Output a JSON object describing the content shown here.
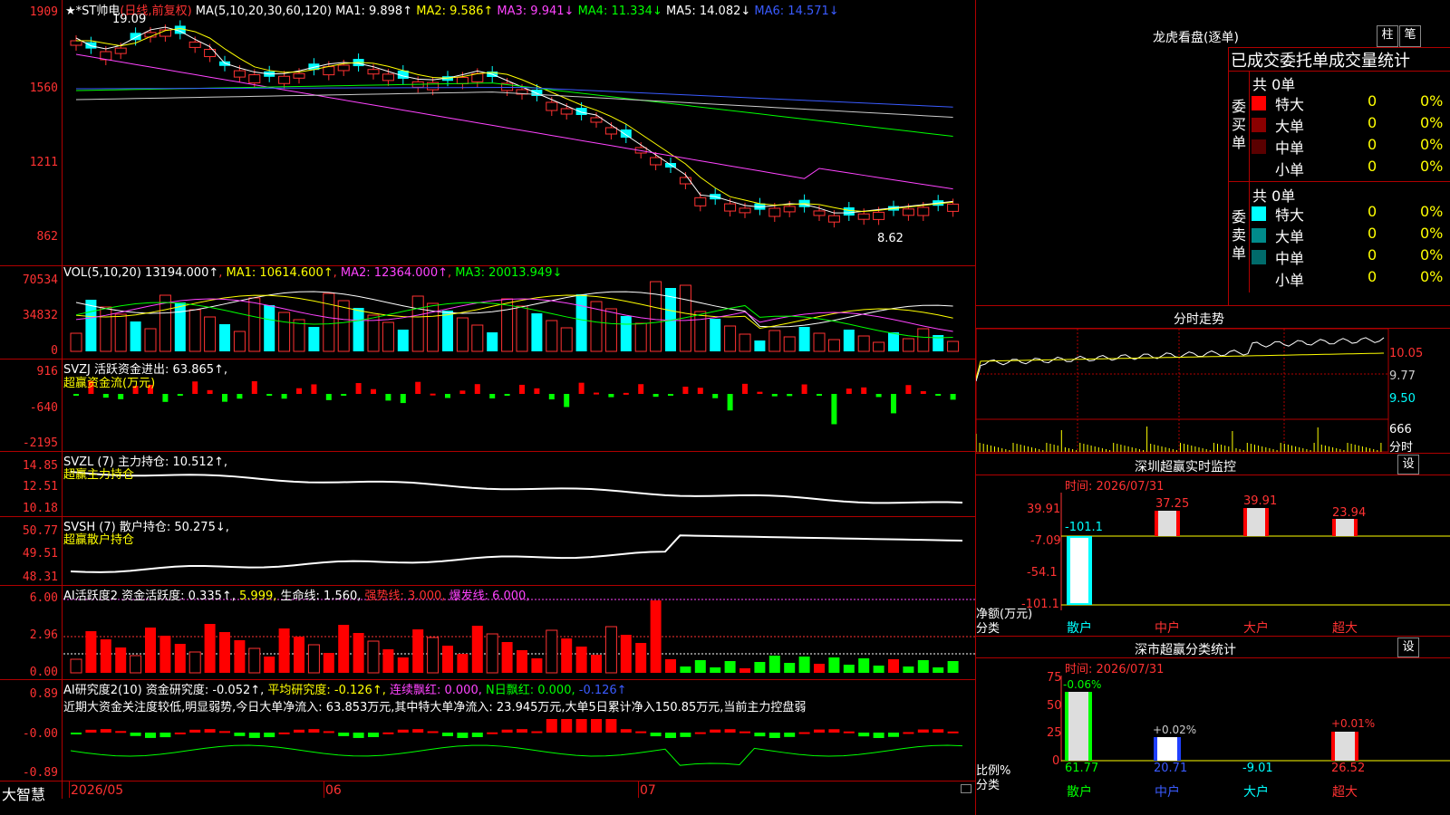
{
  "main_chart": {
    "title_stars": "★*ST帅电",
    "title_mode": "(日线,前复权)",
    "ma_label": "MA(5,10,20,30,60,120)",
    "ma1": "MA1: 9.898↑",
    "ma2": "MA2: 9.586↑",
    "ma3": "MA3: 9.941↓",
    "ma4": "MA4: 11.334↓",
    "ma5": "MA5: 14.082↓",
    "ma6": "MA6: 14.571↓",
    "y_ticks": [
      "1909",
      "1560",
      "1211",
      "862"
    ],
    "high_label": "19.09",
    "low_label": "8.62"
  },
  "vol_panel": {
    "label": "VOL(5,10,20)",
    "vol": "13194.000↑",
    "ma1": "MA1: 10614.600↑",
    "ma2": "MA2: 12364.000↑",
    "ma3": "MA3: 20013.949↓",
    "y_ticks": [
      "70534",
      "34832",
      "0"
    ]
  },
  "svzj_panel": {
    "label": "SVZJ  活跃资金进出: 63.865↑,",
    "sub": "超赢资金流(万元)",
    "y_ticks": [
      "916",
      "-640",
      "-2195"
    ]
  },
  "svzl_panel": {
    "label": "SVZL (7) 主力持仓: 10.512↑,",
    "sub": "超赢主力持仓",
    "y_ticks": [
      "14.85",
      "12.51",
      "10.18"
    ]
  },
  "svsh_panel": {
    "label": "SVSH (7) 散户持仓: 50.275↓,",
    "sub": "超赢散户持仓",
    "y_ticks": [
      "50.77",
      "49.51",
      "48.31"
    ]
  },
  "ai_active_panel": {
    "label1": "AI活跃度2 资金活跃度: 0.335↑,",
    "v2": "5.999,",
    "v3": "生命线: 1.560,",
    "v4": "强势线: 3.000,",
    "v5": "爆发线: 6.000,",
    "y_ticks": [
      "6.00",
      "2.96",
      "0.00"
    ]
  },
  "ai_research_panel": {
    "label1": "AI研究度2(10) 资金研究度: -0.052↑,",
    "v2": "平均研究度: -0.126↑,",
    "v3": "连续飘红: 0.000,",
    "v4": "N日飘红: 0.000,",
    "v5": "-0.126↑",
    "commentary": "近期大资金关注度较低,明显弱势,今日大单净流入: 63.853万元,其中特大单净流入: 23.945万元,大单5日累计净入150.85万元,当前主力控盘弱",
    "y_ticks": [
      "0.89",
      "-0.00",
      "-0.89"
    ]
  },
  "x_axis": {
    "brand": "大智慧",
    "labels": [
      "2026/05",
      "06",
      "07"
    ]
  },
  "right_panel": {
    "lhb_title": "龙虎看盘(逐单)",
    "btn_zhu": "柱",
    "btn_bi": "笔",
    "stats_title": "已成交委托单成交量统计",
    "buy_label": "委买单",
    "sell_label": "委卖单",
    "buy_total": "共 0单",
    "sell_total": "共 0单",
    "buy_rows": [
      {
        "name": "特大",
        "count": "0",
        "pct": "0%",
        "color": "#ff0000"
      },
      {
        "name": "大单",
        "count": "0",
        "pct": "0%",
        "color": "#8b0000"
      },
      {
        "name": "中单",
        "count": "0",
        "pct": "0%",
        "color": "#5a0000"
      },
      {
        "name": "小单",
        "count": "0",
        "pct": "0%",
        "color": "#000000"
      }
    ],
    "sell_rows": [
      {
        "name": "特大",
        "count": "0",
        "pct": "0%",
        "color": "#00ffff"
      },
      {
        "name": "大单",
        "count": "0",
        "pct": "0%",
        "color": "#008b8b"
      },
      {
        "name": "中单",
        "count": "0",
        "pct": "0%",
        "color": "#006b6b"
      },
      {
        "name": "小单",
        "count": "0",
        "pct": "0%",
        "color": "#000000"
      }
    ],
    "fs_title": "分时走势",
    "fs_y": [
      "10.05",
      "9.77",
      "9.50"
    ],
    "fs_vol": "666",
    "fs_label": "分时",
    "sz_title": "深圳超赢实时监控",
    "sz_btn": "设",
    "sz_time": "时间: 2026/07/31",
    "sz_y": [
      "39.91",
      "-7.09",
      "-54.1",
      "-101.1"
    ],
    "sz_vals": [
      "-101.1",
      "37.25",
      "39.91",
      "23.94"
    ],
    "sz_cats": [
      "散户",
      "中户",
      "大户",
      "超大"
    ],
    "sz_unit1": "净额(万元)",
    "sz_unit2": "分类",
    "ss_title": "深市超赢分类统计",
    "ss_btn": "设",
    "ss_time": "时间: 2026/07/31",
    "ss_y": [
      "75",
      "50",
      "25",
      "0"
    ],
    "ss_top": [
      "-0.06%",
      "+0.02%",
      "",
      "+0.01%"
    ],
    "ss_vals": [
      "61.77",
      "20.71",
      "-9.01",
      "26.52"
    ],
    "ss_cats": [
      "散户",
      "中户",
      "大户",
      "超大"
    ],
    "ss_unit1": "比例%",
    "ss_unit2": "分类"
  },
  "colors": {
    "up": "#ff3232",
    "down": "#00ffff",
    "grid": "#b00000"
  }
}
